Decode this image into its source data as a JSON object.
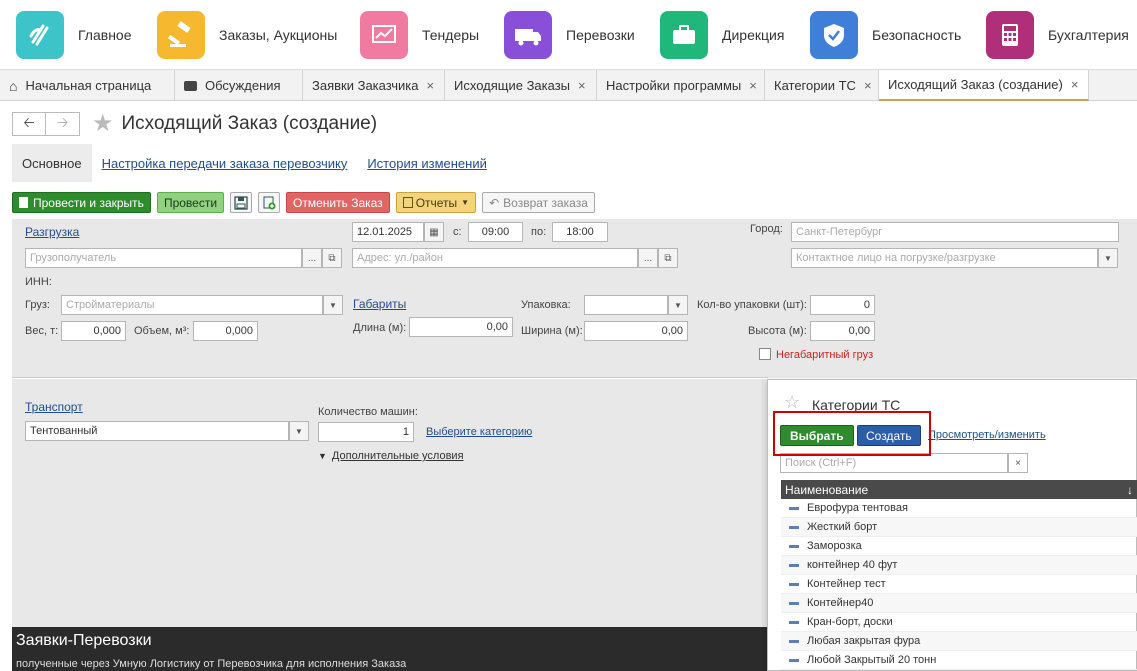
{
  "topnav": {
    "items": [
      {
        "label": "Главное",
        "icon": "logo-icon",
        "color": "#3cc4c8"
      },
      {
        "label": "Заказы, Аукционы",
        "icon": "gavel-icon",
        "color": "#f5b82e"
      },
      {
        "label": "Тендеры",
        "icon": "chart-icon",
        "color": "#f07aa0"
      },
      {
        "label": "Перевозки",
        "icon": "truck-icon",
        "color": "#8a4fd8"
      },
      {
        "label": "Дирекция",
        "icon": "briefcase-icon",
        "color": "#20b87a"
      },
      {
        "label": "Безопасность",
        "icon": "shield-icon",
        "color": "#3f7fd8"
      },
      {
        "label": "Бухгалтерия",
        "icon": "calculator-icon",
        "color": "#b02f7a"
      }
    ]
  },
  "tabs": [
    {
      "label": "Начальная страница",
      "icon": "home-icon"
    },
    {
      "label": "Обсуждения",
      "icon": "chat-icon"
    },
    {
      "label": "Заявки Заказчика",
      "close": "×"
    },
    {
      "label": "Исходящие Заказы",
      "close": "×"
    },
    {
      "label": "Настройки программы",
      "close": "×"
    },
    {
      "label": "Категории ТС",
      "close": "×"
    },
    {
      "label": "Исходящий Заказ (создание)",
      "close": "×"
    }
  ],
  "header": {
    "title": "Исходящий Заказ (создание)"
  },
  "subtabs": [
    "Основное",
    "Настройка передачи заказа перевозчику",
    "История изменений"
  ],
  "toolbar": {
    "post_close": "Провести и закрыть",
    "post": "Провести",
    "cancel_order": "Отменить Заказ",
    "reports": "Отчеты",
    "return_order": "Возврат заказа"
  },
  "form": {
    "unload_link": "Разгрузка",
    "date": "12.01.2025",
    "from_label": "с:",
    "from_time": "09:00",
    "to_label": "по:",
    "to_time": "18:00",
    "city_label": "Город:",
    "city_value": "Санкт-Петербург",
    "consignee_ph": "Грузополучатель",
    "address_ph": "Адрес: ул./район",
    "contact_ph": "Контактное лицо на погрузке/разгрузке",
    "inn_label": "ИНН:",
    "cargo_label": "Груз:",
    "cargo_value": "Стройматериалы",
    "dims_link": "Габариты",
    "pack_label": "Упаковка:",
    "pack_count_label": "Кол-во упаковки (шт):",
    "pack_count": "0",
    "weight_label": "Вес, т:",
    "weight": "0,000",
    "volume_label": "Объем, м³:",
    "volume": "0,000",
    "length_label": "Длина (м):",
    "length": "0,00",
    "width_label": "Ширина (м):",
    "width": "0,00",
    "height_label": "Высота (м):",
    "height": "0,00",
    "oversize_label": "Негабаритный груз",
    "transport_link": "Транспорт",
    "transport_value": "Тентованный",
    "cars_label": "Количество машин:",
    "cars_value": "1",
    "choose_category": "Выберите категорию",
    "extra_conditions": "Дополнительные условия"
  },
  "footer": {
    "title": "Заявки-Перевозки",
    "subtitle": "полученные через Умную Логистику от Перевозчика для исполнения Заказа"
  },
  "popup": {
    "title": "Категории ТС",
    "select": "Выбрать",
    "create": "Создать",
    "view_edit": "Просмотреть/изменить",
    "search_ph": "Поиск (Ctrl+F)",
    "column": "Наименование",
    "rows": [
      "Еврофура тентовая",
      "Жесткий борт",
      "Заморозка",
      "контейнер 40 фут",
      "Контейнер тест",
      "Контейнер40",
      "Кран-борт, доски",
      "Любая закрытая фура",
      "Любой Закрытый 20 тонн"
    ]
  }
}
